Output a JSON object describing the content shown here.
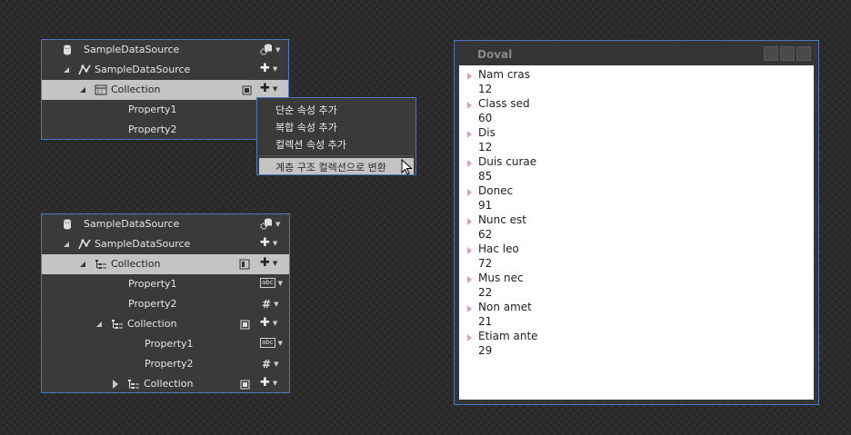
{
  "tree1": {
    "rows": [
      {
        "label": "SampleDataSource",
        "icon": "database-icon"
      },
      {
        "label": "SampleDataSource",
        "icon": "data-source-icon"
      },
      {
        "label": "Collection",
        "icon": "collection-icon"
      },
      {
        "label": "Property1"
      },
      {
        "label": "Property2"
      }
    ]
  },
  "context_menu": {
    "items": [
      "단순 속성 추가",
      "복합 속성 추가",
      "컬렉션 속성 추가"
    ],
    "highlighted": "계층 구조 컬렉션으로 변환"
  },
  "tree2": {
    "rows": [
      {
        "label": "SampleDataSource",
        "icon": "database-icon"
      },
      {
        "label": "SampleDataSource",
        "icon": "data-source-icon"
      },
      {
        "label": "Collection",
        "icon": "hierarchy-collection-icon"
      },
      {
        "label": "Property1",
        "type_icon": "string-type-icon"
      },
      {
        "label": "Property2",
        "type_icon": "number-type-icon"
      },
      {
        "label": "Collection",
        "icon": "hierarchy-collection-icon"
      },
      {
        "label": "Property1",
        "type_icon": "string-type-icon"
      },
      {
        "label": "Property2",
        "type_icon": "number-type-icon"
      },
      {
        "label": "Collection",
        "icon": "hierarchy-collection-icon"
      }
    ]
  },
  "window": {
    "title": "Doval",
    "items": [
      {
        "name": "Nam cras",
        "value": "12"
      },
      {
        "name": "Class sed",
        "value": "60"
      },
      {
        "name": "Dis",
        "value": "12"
      },
      {
        "name": "Duis curae",
        "value": "85"
      },
      {
        "name": "Donec",
        "value": "91"
      },
      {
        "name": "Nunc est",
        "value": "62"
      },
      {
        "name": "Hac leo",
        "value": "72"
      },
      {
        "name": "Mus nec",
        "value": "22"
      },
      {
        "name": "Non amet",
        "value": "21"
      },
      {
        "name": "Etiam ante",
        "value": "29"
      }
    ]
  },
  "colors": {
    "background": "#2b2b2b",
    "panel": "#3a3a3a",
    "border_accent": "#4a78c2",
    "selection": "#c4c4c4"
  }
}
